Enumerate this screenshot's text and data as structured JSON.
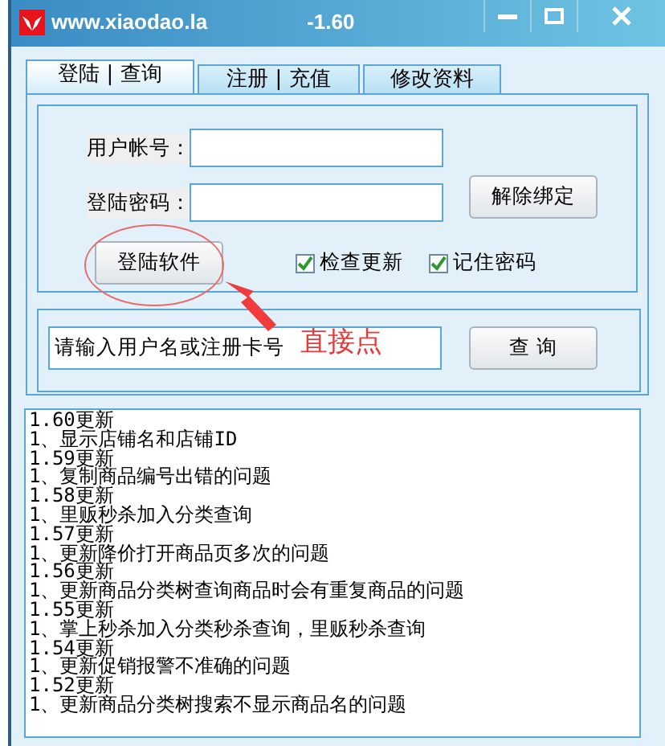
{
  "window": {
    "title": "www.xiaodao.la",
    "version": "-1.60",
    "controls": [
      {
        "kind": "minimize"
      },
      {
        "kind": "maximize"
      },
      {
        "kind": "close"
      }
    ]
  },
  "tabs": [
    {
      "label": "登陆 | 查询",
      "selected": true
    },
    {
      "label": "注册 | 充值",
      "selected": false
    },
    {
      "label": "修改资料",
      "selected": false
    }
  ],
  "login": {
    "account_label": "用户帐号：",
    "password_label": "登陆密码：",
    "unbind_button": "解除绑定",
    "login_button": "登陆软件",
    "checkboxes": [
      {
        "label": "检查更新",
        "checked": true
      },
      {
        "label": "记住密码",
        "checked": true
      }
    ]
  },
  "query": {
    "value": "请输入用户名或注册卡号",
    "button": "查  询"
  },
  "changelog": [
    "1.60更新",
    "1、显示店铺名和店铺ID",
    "1.59更新",
    "1、复制商品编号出错的问题",
    "1.58更新",
    "1、里贩秒杀加入分类查询",
    "1.57更新",
    "1、更新降价打开商品页多次的问题",
    "1.56更新",
    "1、更新商品分类树查询商品时会有重复商品的问题",
    "1.55更新",
    "1、掌上秒杀加入分类秒杀查询，里贩秒杀查询",
    "1.54更新",
    "1、更新促销报警不准确的问题",
    "1.52更新",
    "1、更新商品分类树搜索不显示商品名的问题"
  ],
  "annotation": {
    "text": "直接点"
  }
}
